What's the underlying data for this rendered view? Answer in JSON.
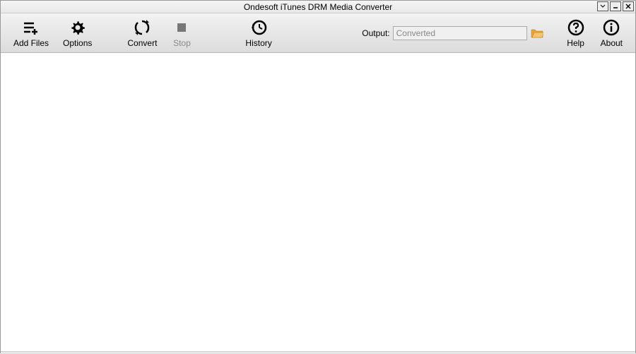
{
  "window": {
    "title": "Ondesoft iTunes DRM Media Converter"
  },
  "toolbar": {
    "add_files": "Add Files",
    "options": "Options",
    "convert": "Convert",
    "stop": "Stop",
    "history": "History",
    "help": "Help",
    "about": "About"
  },
  "output": {
    "label": "Output:",
    "value": "Converted"
  }
}
